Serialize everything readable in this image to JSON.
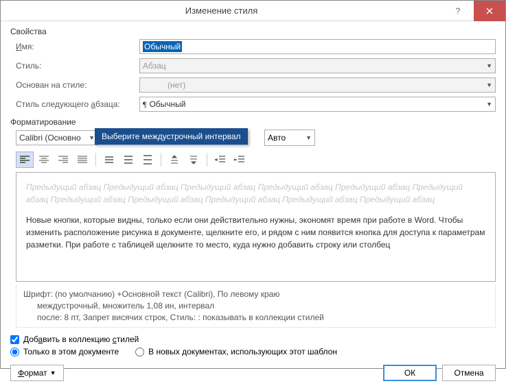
{
  "titlebar": {
    "title": "Изменение стиля"
  },
  "properties": {
    "section_label": "Свойства",
    "name_label": "Имя:",
    "name_value": "Обычный",
    "type_label": "Стиль:",
    "type_value": "Абзац",
    "based_label": "Основан на стиле:",
    "based_value": "(нет)",
    "next_label": "Стиль следующего абзаца:",
    "next_value": "Обычный"
  },
  "formatting": {
    "section_label": "Форматирование",
    "font": "Calibri (Основно",
    "size": "",
    "auto": "Авто",
    "tooltip": "Выберите междустрочный интервал"
  },
  "preview": {
    "ghost_word": "Предыдущий абзац",
    "sample": "Новые кнопки, которые видны, только если они действительно нужны, экономят время при работе в Word. Чтобы изменить расположение рисунка в документе, щелкните его, и рядом с ним появится кнопка для доступа к параметрам разметки.  При работе с таблицей щелкните то место, куда нужно добавить строку или столбец"
  },
  "description": {
    "line1": "Шрифт: (по умолчанию) +Основной текст (Calibri), По левому краю",
    "line2": "междустрочный,  множитель 1,08 ин, интервал",
    "line3": "после: 8 пт, Запрет висячих строк, Стиль: : показывать в коллекции стилей"
  },
  "options": {
    "add_label": "Добавить в коллекцию стилей",
    "only_doc": "Только в этом документе",
    "new_docs": "В новых документах, использующих этот шаблон"
  },
  "bottom": {
    "format": "Формат",
    "ok": "ОК",
    "cancel": "Отмена"
  }
}
